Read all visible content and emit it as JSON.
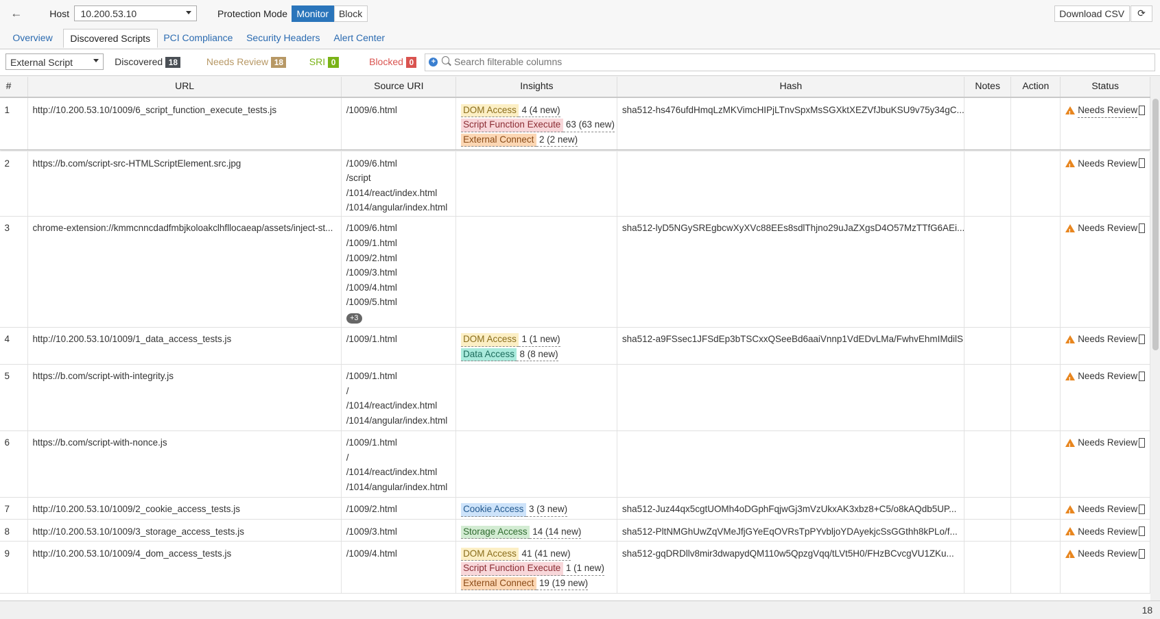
{
  "header": {
    "back_icon": "arrow-left-icon",
    "host_label": "Host",
    "host_value": "10.200.53.10",
    "mode_label": "Protection Mode",
    "mode_monitor": "Monitor",
    "mode_block": "Block",
    "mode_selected": "Monitor",
    "download_csv": "Download CSV",
    "refresh_icon": "refresh-icon"
  },
  "tabs": [
    {
      "label": "Overview"
    },
    {
      "label": "Discovered Scripts",
      "active": true
    },
    {
      "label": "PCI Compliance"
    },
    {
      "label": "Security Headers"
    },
    {
      "label": "Alert Center"
    }
  ],
  "filters": {
    "type_value": "External Script",
    "discovered": {
      "label": "Discovered",
      "count": "18",
      "color": "#4a4f55"
    },
    "needs_review": {
      "label": "Needs Review",
      "count": "18",
      "color": "#b79865"
    },
    "sri": {
      "label": "SRI",
      "count": "0",
      "color": "#7ab317"
    },
    "blocked": {
      "label": "Blocked",
      "count": "0",
      "color": "#d9534f"
    },
    "search_placeholder": "Search filterable columns"
  },
  "columns": [
    "#",
    "URL",
    "Source URI",
    "Insights",
    "Hash",
    "Notes",
    "Action",
    "Status"
  ],
  "insight_colors": {
    "DOM Access": [
      "#fcefc5",
      "#8a6d1b"
    ],
    "Script Function Execute": [
      "#f8d7da",
      "#8b2c33"
    ],
    "External Connect": [
      "#fcd7b4",
      "#8a4a16"
    ],
    "Data Access": [
      "#a9eadc",
      "#1c6b5c"
    ],
    "Cookie Access": [
      "#cde3fa",
      "#245a8f"
    ],
    "Storage Access": [
      "#d3ecd3",
      "#2f6b2f"
    ]
  },
  "rows": [
    {
      "num": "1",
      "url": "http://10.200.53.10/1009/6_script_function_execute_tests.js",
      "sources": [
        "/1009/6.html"
      ],
      "insights": [
        {
          "tag": "DOM Access",
          "value": "4 (4 new)"
        },
        {
          "tag": "Script Function Execute",
          "value": "63 (63 new)"
        },
        {
          "tag": "External Connect",
          "value": "2 (2 new)"
        }
      ],
      "hash": "sha512-hs476ufdHmqLzMKVimcHIPjLTnvSpxMsSGXktXEZVfJbuKSU9v75y34gC...",
      "status": "Needs Review"
    },
    {
      "num": "2",
      "url": "https://b.com/script-src-HTMLScriptElement.src.jpg",
      "sources": [
        "/1009/6.html",
        "/script",
        "/1014/react/index.html",
        "/1014/angular/index.html"
      ],
      "insights": [],
      "hash": "",
      "status": "Needs Review"
    },
    {
      "num": "3",
      "url": "chrome-extension://kmmcnncdadfmbjkoloakclhfllocaeap/assets/inject-st...",
      "sources": [
        "/1009/6.html",
        "/1009/1.html",
        "/1009/2.html",
        "/1009/3.html",
        "/1009/4.html",
        "/1009/5.html"
      ],
      "more": "+3",
      "insights": [],
      "hash": "sha512-lyD5NGySREgbcwXyXVc88EEs8sdlThjno29uJaZXgsD4O57MzTTfG6AEi...",
      "status": "Needs Review"
    },
    {
      "num": "4",
      "url": "http://10.200.53.10/1009/1_data_access_tests.js",
      "sources": [
        "/1009/1.html"
      ],
      "insights": [
        {
          "tag": "DOM Access",
          "value": "1 (1 new)"
        },
        {
          "tag": "Data Access",
          "value": "8 (8 new)"
        }
      ],
      "hash": "sha512-a9FSsec1JFSdEp3bTSCxxQSeeBd6aaiVnnp1VdEDvLMa/FwhvEhmIMdilS...",
      "status": "Needs Review"
    },
    {
      "num": "5",
      "url": "https://b.com/script-with-integrity.js",
      "sources": [
        "/1009/1.html",
        "/",
        "/1014/react/index.html",
        "/1014/angular/index.html"
      ],
      "insights": [],
      "hash": "",
      "status": "Needs Review"
    },
    {
      "num": "6",
      "url": "https://b.com/script-with-nonce.js",
      "sources": [
        "/1009/1.html",
        "/",
        "/1014/react/index.html",
        "/1014/angular/index.html"
      ],
      "insights": [],
      "hash": "",
      "status": "Needs Review"
    },
    {
      "num": "7",
      "url": "http://10.200.53.10/1009/2_cookie_access_tests.js",
      "sources": [
        "/1009/2.html"
      ],
      "insights": [
        {
          "tag": "Cookie Access",
          "value": "3 (3 new)"
        }
      ],
      "hash": "sha512-Juz44qx5cgtUOMh4oDGphFqjwGj3mVzUkxAK3xbz8+C5/o8kAQdb5UP...",
      "status": "Needs Review"
    },
    {
      "num": "8",
      "url": "http://10.200.53.10/1009/3_storage_access_tests.js",
      "sources": [
        "/1009/3.html"
      ],
      "insights": [
        {
          "tag": "Storage Access",
          "value": "14 (14 new)"
        }
      ],
      "hash": "sha512-PltNMGhUwZqVMeJfjGYeEqOVRsTpPYvbljoYDAyekjcSsGGthh8kPLo/f...",
      "status": "Needs Review"
    },
    {
      "num": "9",
      "url": "http://10.200.53.10/1009/4_dom_access_tests.js",
      "sources": [
        "/1009/4.html"
      ],
      "insights": [
        {
          "tag": "DOM Access",
          "value": "41 (41 new)"
        },
        {
          "tag": "Script Function Execute",
          "value": "1 (1 new)"
        },
        {
          "tag": "External Connect",
          "value": "19 (19 new)"
        }
      ],
      "hash": "sha512-gqDRDllv8mir3dwapydQM110w5QpzgVqq/tLVt5H0/FHzBCvcgVU1ZKu...",
      "status": "Needs Review"
    }
  ],
  "footer": {
    "total": "18"
  }
}
